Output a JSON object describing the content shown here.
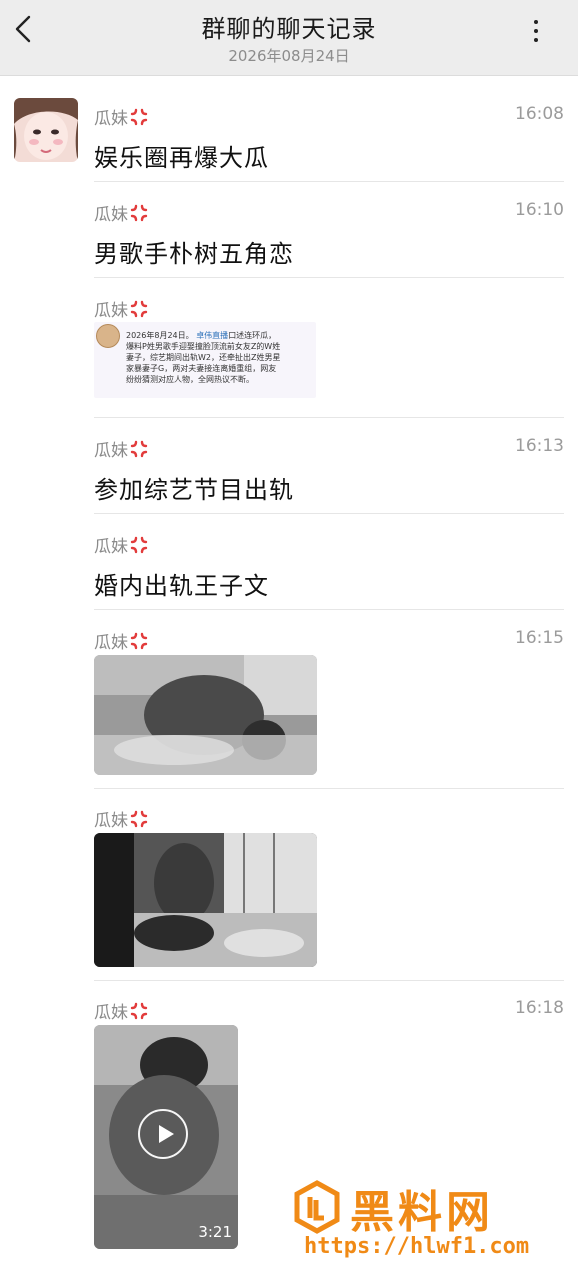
{
  "header": {
    "title": "群聊的聊天记录",
    "date": "2026年08月24日"
  },
  "messages": [
    {
      "sender": "瓜妹",
      "time": "16:08",
      "text": "娱乐圈再爆大瓜"
    },
    {
      "sender": "瓜妹",
      "time": "16:10",
      "text": "男歌手朴树五角恋"
    },
    {
      "sender": "瓜妹",
      "time": "",
      "image_text": {
        "line1": "2026年8月24日。",
        "tag": "卓伟直播",
        "line1b": "口述连环瓜，",
        "line2": "爆料P姓男歌手迎娶撞脸顶流前女友Z的W姓",
        "line3": "妻子，综艺期间出轨W2，还牵扯出Z姓男星",
        "line4": "家暴妻子G，两对夫妻接连离婚重组，网友",
        "line5": "纷纷猜测对应人物，全网热议不断。"
      }
    },
    {
      "sender": "瓜妹",
      "time": "16:13",
      "text": "参加综艺节目出轨"
    },
    {
      "sender": "瓜妹",
      "time": "",
      "text": "婚内出轨王子文"
    },
    {
      "sender": "瓜妹",
      "time": "16:15"
    },
    {
      "sender": "瓜妹",
      "time": ""
    },
    {
      "sender": "瓜妹",
      "time": "16:18",
      "video_duration": "3:21"
    }
  ],
  "watermark": {
    "brand": "黑料网",
    "url": "https://hlwf1.com"
  },
  "colors": {
    "header_bg": "#ededed",
    "sender_gray": "#8a8a8a",
    "anger_red": "#e23b3b",
    "watermark_orange": "#f08a16"
  },
  "icons": [
    "back-arrow-icon",
    "more-vertical-icon",
    "anger-emoji-icon",
    "play-icon"
  ]
}
